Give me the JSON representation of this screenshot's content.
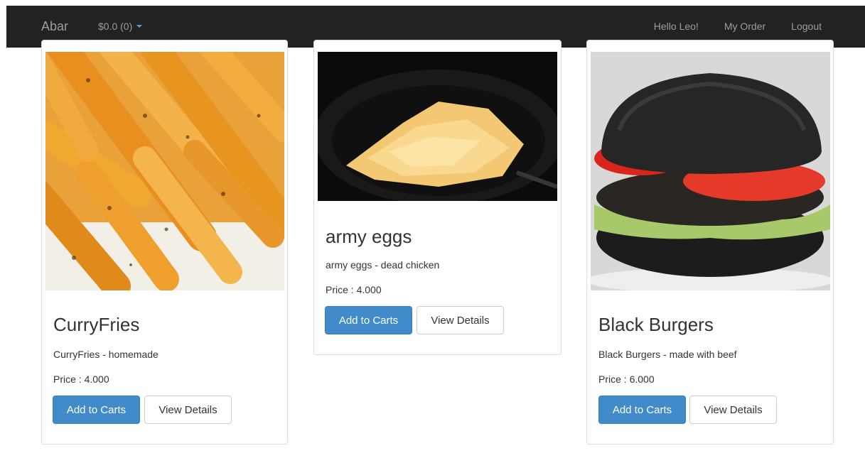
{
  "navbar": {
    "brand": "Abar",
    "cart_label": "$0.0 (0)",
    "greeting": "Hello Leo!",
    "my_order": "My Order",
    "logout": "Logout"
  },
  "products": [
    {
      "title": "CurryFries",
      "description": "CurryFries - homemade",
      "price": "Price : 4.000",
      "add_label": "Add to Carts",
      "details_label": "View Details"
    },
    {
      "title": "army eggs",
      "description": "army eggs - dead chicken",
      "price": "Price : 4.000",
      "add_label": "Add to Carts",
      "details_label": "View Details"
    },
    {
      "title": "Black Burgers",
      "description": "Black Burgers - made with beef",
      "price": "Price : 6.000",
      "add_label": "Add to Carts",
      "details_label": "View Details"
    }
  ],
  "colors": {
    "navbar": "#222222",
    "primary": "#428bca",
    "caret": "#4aa3e6"
  }
}
